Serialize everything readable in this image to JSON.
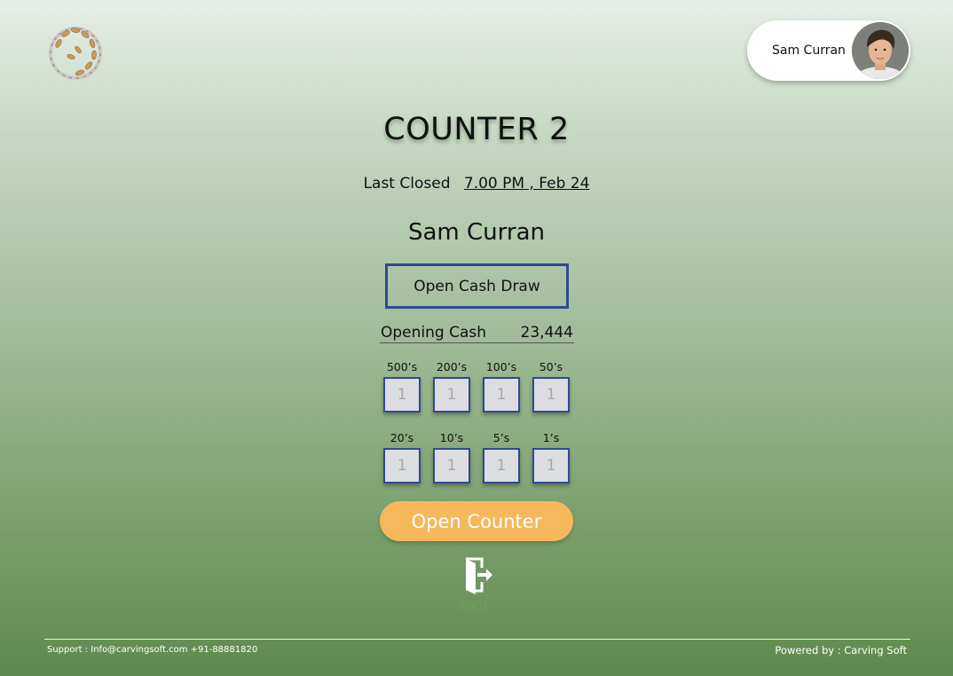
{
  "header": {
    "user_name": "Sam Curran"
  },
  "main": {
    "title": "COUNTER 2",
    "last_closed_label": "Last Closed",
    "last_closed_value": "7.00 PM , Feb 24",
    "operator_name": "Sam Curran",
    "open_cash_draw_label": "Open Cash Draw",
    "opening_cash_label": "Opening Cash",
    "opening_cash_value": "23,444",
    "denominations": [
      {
        "label": "500’s",
        "value": "1"
      },
      {
        "label": "200’s",
        "value": "1"
      },
      {
        "label": "100’s",
        "value": "1"
      },
      {
        "label": "50’s",
        "value": "1"
      },
      {
        "label": "20’s",
        "value": "1"
      },
      {
        "label": "10’s",
        "value": "1"
      },
      {
        "label": "5’s",
        "value": "1"
      },
      {
        "label": "1’s",
        "value": "1"
      }
    ],
    "open_counter_label": "Open Counter",
    "exit_label": "exit"
  },
  "footer": {
    "support_text": "Support : Info@carvingsoft.com  +91-88881820",
    "powered_by": "Powered by : Carving Soft"
  },
  "colors": {
    "accent_border": "#2e4a93",
    "button_orange": "#f7b85b",
    "exit_green": "#6e9a63"
  }
}
